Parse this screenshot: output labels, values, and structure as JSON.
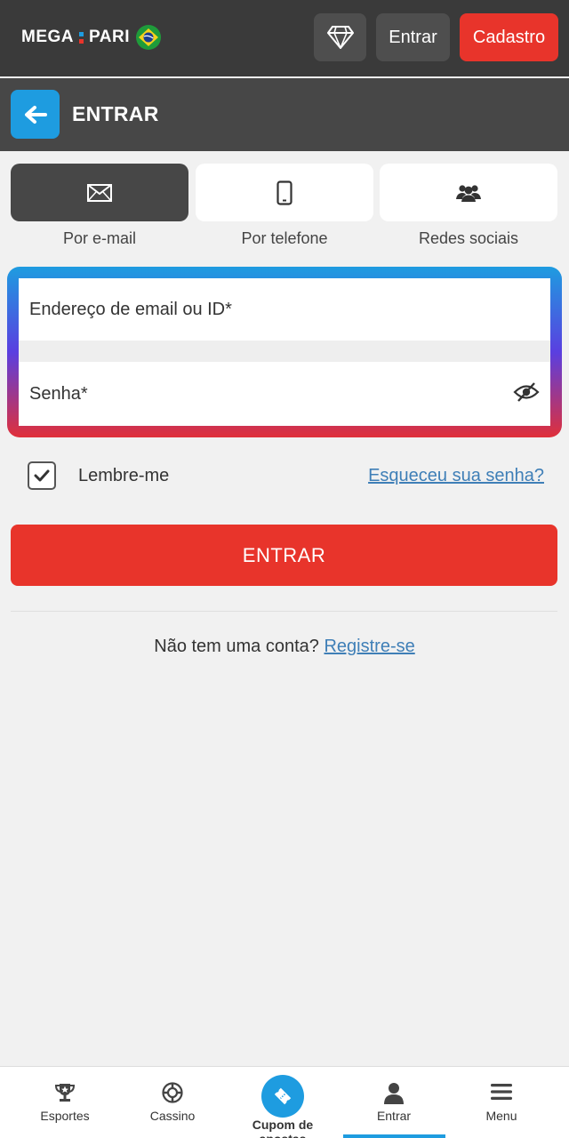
{
  "brand": {
    "logo_left": "MEGA",
    "logo_right": "PARI",
    "flag_icon": "brazil-flag-icon"
  },
  "topbar": {
    "diamond_icon": "diamond-icon",
    "entrar_label": "Entrar",
    "cadastro_label": "Cadastro"
  },
  "header": {
    "back_icon": "arrow-left-icon",
    "title": "ENTRAR"
  },
  "methods": [
    {
      "label": "Por e-mail",
      "icon": "envelope-icon",
      "active": true
    },
    {
      "label": "Por telefone",
      "icon": "phone-icon",
      "active": false
    },
    {
      "label": "Redes sociais",
      "icon": "users-icon",
      "active": false
    }
  ],
  "form": {
    "email_placeholder": "Endereço de email ou ID*",
    "password_placeholder": "Senha*",
    "eye_icon": "eye-slash-icon"
  },
  "remember": {
    "label": "Lembre-me",
    "checked": true,
    "forgot_link": "Esqueceu sua senha?"
  },
  "login_button": "ENTRAR",
  "signup": {
    "text": "Não tem uma conta?",
    "link": "Registre-se"
  },
  "bottom_nav": [
    {
      "label": "Esportes",
      "icon": "trophy-icon"
    },
    {
      "label": "Cassino",
      "icon": "casino-chip-icon"
    },
    {
      "label": "Cupom de apostas",
      "icon": "ticket-icon"
    },
    {
      "label": "Entrar",
      "icon": "user-icon"
    },
    {
      "label": "Menu",
      "icon": "hamburger-icon"
    }
  ],
  "colors": {
    "accent_red": "#e8342b",
    "accent_blue": "#1e9ce0",
    "topbar": "#3a3a3a",
    "link": "#3f7fb7"
  }
}
